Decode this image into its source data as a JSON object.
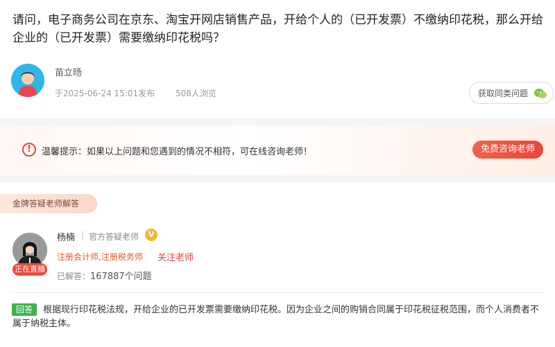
{
  "question": {
    "title": "请问，电子商务公司在京东、淘宝开网店销售产品，开给个人的（已开发票）不缴纳印花税，那么开给企业的（已开发票）需要缴纳印花税吗？"
  },
  "asker": {
    "name": "苗立旸",
    "posted": "于2025-06-24  15:01发布",
    "views": "508人浏览",
    "similar_button": "获取同类问题"
  },
  "tip": {
    "text": "温馨提示：如果以上问题和您遇到的情况不相符，可在线咨询老师！",
    "consult_button": "免费咨询老师"
  },
  "section": {
    "title": "金牌答疑老师解答"
  },
  "teacher": {
    "name": "杨楠",
    "separator": "|",
    "role": "官方答疑老师",
    "v_badge": "V",
    "live_badge": "正在直播",
    "certification": "注册会计师,注册税务师",
    "follow_label": "关注老师",
    "answered_prefix": "已解答：",
    "answered_count": "167887个问题"
  },
  "answer": {
    "tag": "回答",
    "text": "根据现行印花税法规，开给企业的已开发票需要缴纳印花税。因为企业之间的购销合同属于印花税征税范围，而个人消费者不属于纳税主体。"
  },
  "colors": {
    "accent_red": "#e5453d",
    "answer_green": "#3fb34f",
    "cert_orange": "#e05a2b",
    "verified_gold": "#f3b82e"
  },
  "icons": {
    "tip": "warning-circle-icon",
    "similar": "wechat-icon",
    "verified": "verified-v-icon"
  }
}
